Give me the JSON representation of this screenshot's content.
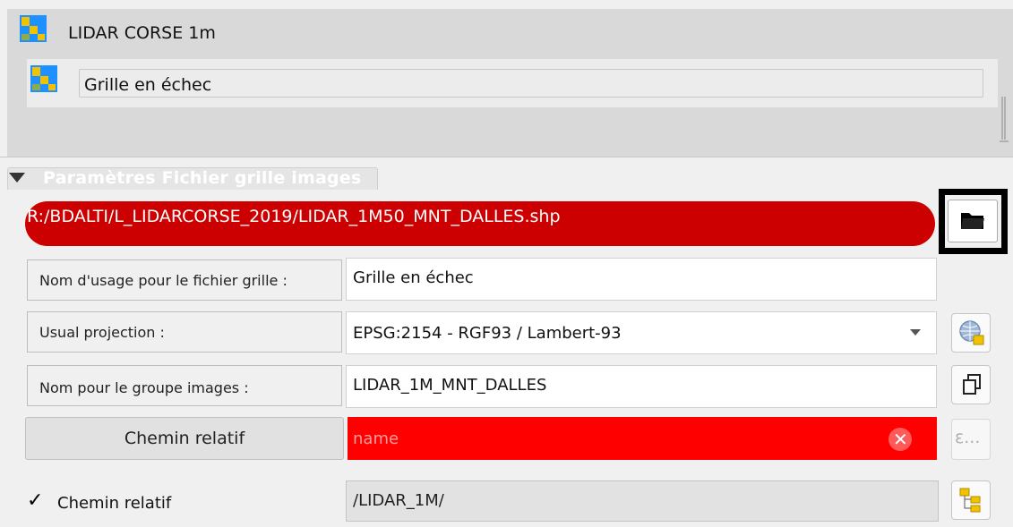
{
  "tree": {
    "layer_group_title": "LIDAR CORSE 1m",
    "layer_name": "Grille en échec",
    "layer_icon_name": "layer-icon",
    "icon_colors": {
      "blue": "#1e90ff",
      "yellow": "#f2c200",
      "olive": "#8cab4c"
    }
  },
  "section": {
    "title": "Paramètres Fichier grille images"
  },
  "file_path": {
    "value": "R:/BDALTI/L_LIDARCORSE_2019/LIDAR_1M50_MNT_DALLES.shp",
    "status_color": "#cc0000",
    "browse_icon": "folder-open-icon"
  },
  "form": {
    "usage_name_label": "Nom d'usage pour le fichier grille :",
    "usage_name_value": "Grille en échec",
    "projection_label": "Usual projection :",
    "projection_value": "EPSG:2154 - RGF93 / Lambert-93",
    "projection_icon": "projection-selector-icon",
    "group_label": "Nom pour le groupe images :",
    "group_value": "LIDAR_1M_MNT_DALLES",
    "copy_icon": "copy-icon",
    "relative_path_button": "Chemin relatif",
    "expression_placeholder": "name",
    "expression_button": "ε...",
    "expression_error_color": "#ff0000",
    "relative_path_checkbox_label": "Chemin relatif",
    "relative_path_checked": true,
    "relative_path_value": "/LIDAR_1M/",
    "tree_icon": "folder-tree-icon"
  }
}
